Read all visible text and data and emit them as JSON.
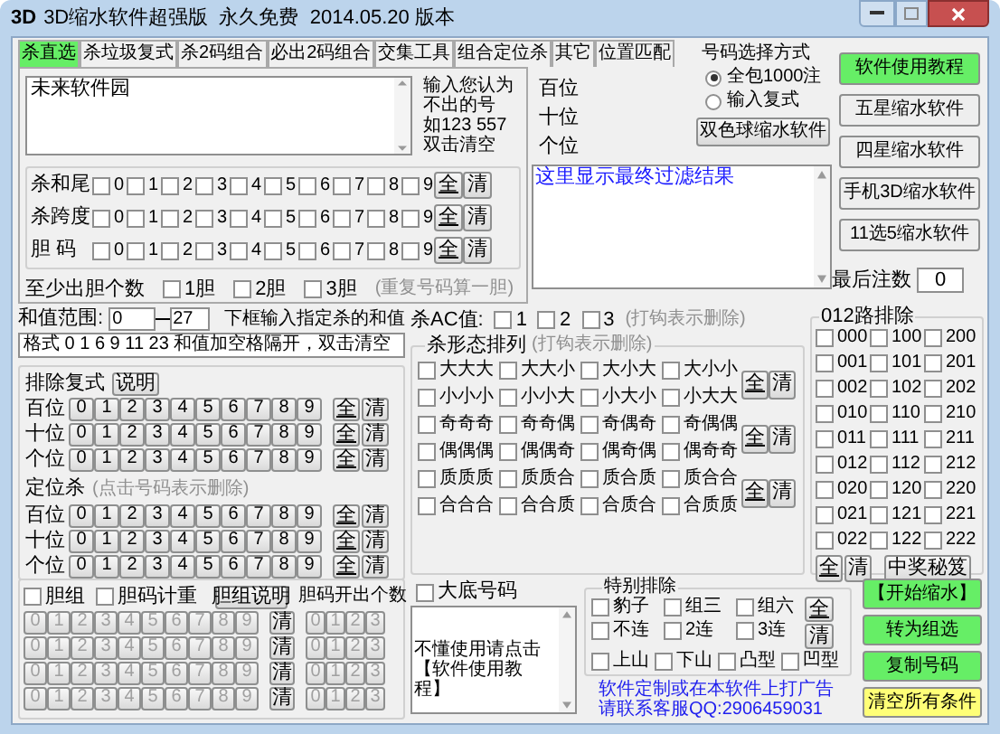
{
  "window": {
    "icon": "3D",
    "title": "3D缩水软件超强版  永久免费  2014.05.20 版本"
  },
  "tabs": [
    {
      "label": "杀直选",
      "selected": true
    },
    {
      "label": "杀垃圾复式",
      "selected": false
    },
    {
      "label": "杀2码组合",
      "selected": false
    },
    {
      "label": "必出2码组合",
      "selected": false
    },
    {
      "label": "交集工具",
      "selected": false
    },
    {
      "label": "组合定位杀",
      "selected": false
    },
    {
      "label": "其它",
      "selected": false
    },
    {
      "label": "位置匹配",
      "selected": false
    }
  ],
  "kill_input": {
    "value": "未来软件园",
    "hint": [
      "输入您认为",
      "不出的号",
      "如123 557",
      "双击清空"
    ]
  },
  "checkbox_rows": [
    {
      "label": "杀和尾",
      "all": "全",
      "clear": "清",
      "options": [
        {
          "label": "0",
          "checked": false
        },
        {
          "label": "1",
          "checked": false
        },
        {
          "label": "2",
          "checked": false
        },
        {
          "label": "3",
          "checked": false
        },
        {
          "label": "4",
          "checked": false
        },
        {
          "label": "5",
          "checked": false
        },
        {
          "label": "6",
          "checked": false
        },
        {
          "label": "7",
          "checked": false
        },
        {
          "label": "8",
          "checked": false
        },
        {
          "label": "9",
          "checked": false
        }
      ]
    },
    {
      "label": "杀跨度",
      "all": "全",
      "clear": "清",
      "options": [
        {
          "label": "0",
          "checked": false
        },
        {
          "label": "1",
          "checked": false
        },
        {
          "label": "2",
          "checked": false
        },
        {
          "label": "3",
          "checked": false
        },
        {
          "label": "4",
          "checked": false
        },
        {
          "label": "5",
          "checked": false
        },
        {
          "label": "6",
          "checked": false
        },
        {
          "label": "7",
          "checked": false
        },
        {
          "label": "8",
          "checked": false
        },
        {
          "label": "9",
          "checked": false
        }
      ]
    },
    {
      "label": "胆 码",
      "all": "全",
      "clear": "清",
      "options": [
        {
          "label": "0",
          "checked": false
        },
        {
          "label": "1",
          "checked": false
        },
        {
          "label": "2",
          "checked": false
        },
        {
          "label": "3",
          "checked": false
        },
        {
          "label": "4",
          "checked": false
        },
        {
          "label": "5",
          "checked": false
        },
        {
          "label": "6",
          "checked": false
        },
        {
          "label": "7",
          "checked": false
        },
        {
          "label": "8",
          "checked": false
        },
        {
          "label": "9",
          "checked": false
        }
      ]
    }
  ],
  "min_dan": {
    "label": "至少出胆个数",
    "note": "(重复号码算一胆)",
    "options": [
      {
        "label": "1胆",
        "checked": false
      },
      {
        "label": "2胆",
        "checked": false
      },
      {
        "label": "3胆",
        "checked": false
      }
    ]
  },
  "position_labels": [
    "百位",
    "十位",
    "个位"
  ],
  "select_mode": {
    "title": "号码选择方式",
    "options": [
      {
        "label": "全包1000注",
        "selected": true
      },
      {
        "label": "输入复式",
        "selected": false
      }
    ]
  },
  "ssq_button": "双色球缩水软件",
  "result": {
    "value": "这里显示最终过滤结果"
  },
  "side_buttons": [
    {
      "label": "软件使用教程",
      "color": "#66ee66"
    },
    {
      "label": "五星缩水软件",
      "color": "#eeeeee"
    },
    {
      "label": "四星缩水软件",
      "color": "#eeeeee"
    },
    {
      "label": "手机3D缩水软件",
      "color": "#eeeeee"
    },
    {
      "label": "11选5缩水软件",
      "color": "#eeeeee"
    }
  ],
  "final_count": {
    "label": "最后注数",
    "value": "0"
  },
  "sum_range": {
    "label": "和值范围:",
    "from": "0",
    "to": "27",
    "note": "下框输入指定杀的和值",
    "input": "格式 0 1 6 9 11 23 和值加空格隔开，双击清空"
  },
  "exclude_compound": {
    "title": "排除复式",
    "help": "说明",
    "rows": [
      {
        "label": "百位",
        "digits": [
          "0",
          "1",
          "2",
          "3",
          "4",
          "5",
          "6",
          "7",
          "8",
          "9"
        ],
        "all": "全",
        "clear": "清"
      },
      {
        "label": "十位",
        "digits": [
          "0",
          "1",
          "2",
          "3",
          "4",
          "5",
          "6",
          "7",
          "8",
          "9"
        ],
        "all": "全",
        "clear": "清"
      },
      {
        "label": "个位",
        "digits": [
          "0",
          "1",
          "2",
          "3",
          "4",
          "5",
          "6",
          "7",
          "8",
          "9"
        ],
        "all": "全",
        "clear": "清"
      }
    ]
  },
  "position_kill": {
    "title": "定位杀",
    "note": "(点击号码表示删除)",
    "rows": [
      {
        "label": "百位",
        "digits": [
          "0",
          "1",
          "2",
          "3",
          "4",
          "5",
          "6",
          "7",
          "8",
          "9"
        ],
        "all": "全",
        "clear": "清"
      },
      {
        "label": "十位",
        "digits": [
          "0",
          "1",
          "2",
          "3",
          "4",
          "5",
          "6",
          "7",
          "8",
          "9"
        ],
        "all": "全",
        "clear": "清"
      },
      {
        "label": "个位",
        "digits": [
          "0",
          "1",
          "2",
          "3",
          "4",
          "5",
          "6",
          "7",
          "8",
          "9"
        ],
        "all": "全",
        "clear": "清"
      }
    ]
  },
  "dan_group": {
    "options": [
      {
        "label": "胆组",
        "checked": false
      },
      {
        "label": "胆码计重",
        "checked": false
      }
    ],
    "help": "胆组说明",
    "count_title": "胆码开出个数",
    "rows": [
      {
        "disabled": true,
        "digits": [
          "0",
          "1",
          "2",
          "3",
          "4",
          "5",
          "6",
          "7",
          "8",
          "9"
        ],
        "clear": "清",
        "counts": [
          "0",
          "1",
          "2",
          "3"
        ]
      },
      {
        "disabled": true,
        "digits": [
          "0",
          "1",
          "2",
          "3",
          "4",
          "5",
          "6",
          "7",
          "8",
          "9"
        ],
        "clear": "清",
        "counts": [
          "0",
          "1",
          "2",
          "3"
        ]
      },
      {
        "disabled": true,
        "digits": [
          "0",
          "1",
          "2",
          "3",
          "4",
          "5",
          "6",
          "7",
          "8",
          "9"
        ],
        "clear": "清",
        "counts": [
          "0",
          "1",
          "2",
          "3"
        ]
      },
      {
        "disabled": true,
        "digits": [
          "0",
          "1",
          "2",
          "3",
          "4",
          "5",
          "6",
          "7",
          "8",
          "9"
        ],
        "clear": "清",
        "counts": [
          "0",
          "1",
          "2",
          "3"
        ]
      }
    ]
  },
  "ac": {
    "label": "杀AC值:",
    "note": "(打钩表示删除)",
    "options": [
      {
        "label": "1",
        "checked": false
      },
      {
        "label": "2",
        "checked": false
      },
      {
        "label": "3",
        "checked": false
      }
    ]
  },
  "shape": {
    "title": "杀形态排列",
    "note": "(打钩表示删除)",
    "blocks": [
      {
        "all": "全",
        "clear": "清",
        "options": [
          {
            "label": "大大大",
            "checked": false
          },
          {
            "label": "大大小",
            "checked": false
          },
          {
            "label": "大小大",
            "checked": false
          },
          {
            "label": "大小小",
            "checked": false
          },
          {
            "label": "小小小",
            "checked": false
          },
          {
            "label": "小小大",
            "checked": false
          },
          {
            "label": "小大小",
            "checked": false
          },
          {
            "label": "小大大",
            "checked": false
          }
        ]
      },
      {
        "all": "全",
        "clear": "清",
        "options": [
          {
            "label": "奇奇奇",
            "checked": false
          },
          {
            "label": "奇奇偶",
            "checked": false
          },
          {
            "label": "奇偶奇",
            "checked": false
          },
          {
            "label": "奇偶偶",
            "checked": false
          },
          {
            "label": "偶偶偶",
            "checked": false
          },
          {
            "label": "偶偶奇",
            "checked": false
          },
          {
            "label": "偶奇偶",
            "checked": false
          },
          {
            "label": "偶奇奇",
            "checked": false
          }
        ]
      },
      {
        "all": "全",
        "clear": "清",
        "options": [
          {
            "label": "质质质",
            "checked": false
          },
          {
            "label": "质质合",
            "checked": false
          },
          {
            "label": "质合质",
            "checked": false
          },
          {
            "label": "质合合",
            "checked": false
          },
          {
            "label": "合合合",
            "checked": false
          },
          {
            "label": "合合质",
            "checked": false
          },
          {
            "label": "合质合",
            "checked": false
          },
          {
            "label": "合质质",
            "checked": false
          }
        ]
      }
    ]
  },
  "route012": {
    "title": "012路排除",
    "all": "全",
    "clear": "清",
    "secret": "中奖秘笈",
    "options": [
      {
        "label": "000",
        "checked": false
      },
      {
        "label": "100",
        "checked": false
      },
      {
        "label": "200",
        "checked": false
      },
      {
        "label": "001",
        "checked": false
      },
      {
        "label": "101",
        "checked": false
      },
      {
        "label": "201",
        "checked": false
      },
      {
        "label": "002",
        "checked": false
      },
      {
        "label": "102",
        "checked": false
      },
      {
        "label": "202",
        "checked": false
      },
      {
        "label": "010",
        "checked": false
      },
      {
        "label": "110",
        "checked": false
      },
      {
        "label": "210",
        "checked": false
      },
      {
        "label": "011",
        "checked": false
      },
      {
        "label": "111",
        "checked": false
      },
      {
        "label": "211",
        "checked": false
      },
      {
        "label": "012",
        "checked": false
      },
      {
        "label": "112",
        "checked": false
      },
      {
        "label": "212",
        "checked": false
      },
      {
        "label": "020",
        "checked": false
      },
      {
        "label": "120",
        "checked": false
      },
      {
        "label": "220",
        "checked": false
      },
      {
        "label": "021",
        "checked": false
      },
      {
        "label": "121",
        "checked": false
      },
      {
        "label": "221",
        "checked": false
      },
      {
        "label": "022",
        "checked": false
      },
      {
        "label": "122",
        "checked": false
      },
      {
        "label": "222",
        "checked": false
      }
    ]
  },
  "base_numbers": {
    "label": "大底号码",
    "checked": false,
    "value": "不懂使用请点击【软件使用教程】"
  },
  "special": {
    "title": "特别排除",
    "all": "全",
    "clear": "清",
    "rows": [
      [
        {
          "label": "豹子",
          "checked": false
        },
        {
          "label": "组三",
          "checked": false
        },
        {
          "label": "组六",
          "checked": false
        }
      ],
      [
        {
          "label": "不连",
          "checked": false
        },
        {
          "label": "2连",
          "checked": false
        },
        {
          "label": "3连",
          "checked": false
        }
      ],
      [
        {
          "label": "上山",
          "checked": false
        },
        {
          "label": "下山",
          "checked": false
        },
        {
          "label": "凸型",
          "checked": false
        },
        {
          "label": "凹型",
          "checked": false
        }
      ]
    ]
  },
  "ad": [
    "软件定制或在本软件上打广告",
    "请联系客服QQ:2906459031"
  ],
  "action_buttons": [
    {
      "label": "【开始缩水】",
      "color": "#66ee66"
    },
    {
      "label": "转为组选",
      "color": "#66ee66"
    },
    {
      "label": "复制号码",
      "color": "#66ee66"
    },
    {
      "label": "清空所有条件",
      "color": "#ffff77"
    }
  ]
}
